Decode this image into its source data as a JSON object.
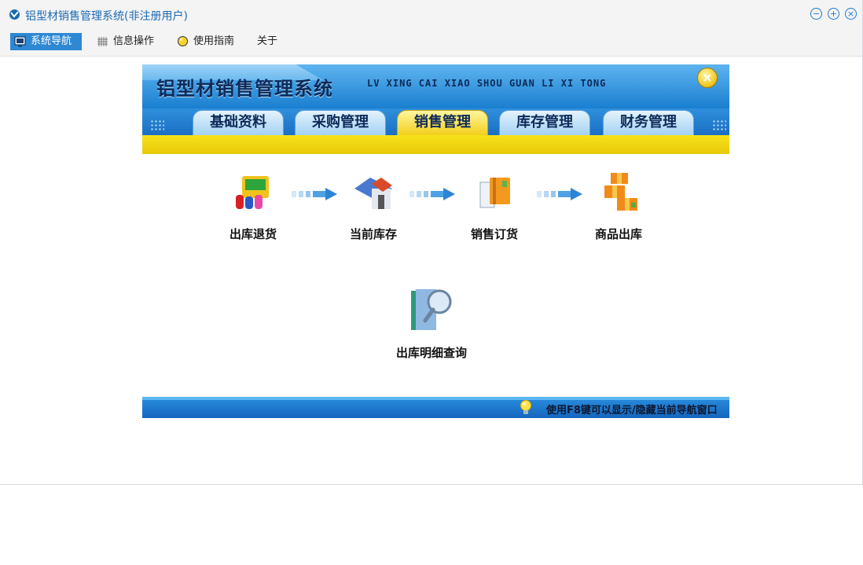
{
  "window": {
    "title": "铝型材销售管理系统(非注册用户)",
    "controls": {
      "minimize": "−",
      "maximize": "+",
      "close": "×"
    }
  },
  "menu": {
    "items": [
      {
        "label": "系统导航",
        "icon": "monitor-icon",
        "active": true
      },
      {
        "label": "信息操作",
        "icon": "grid-icon",
        "active": false
      },
      {
        "label": "使用指南",
        "icon": "lightbulb-icon",
        "active": false
      },
      {
        "label": "关于",
        "icon": "",
        "active": false
      }
    ]
  },
  "banner": {
    "title": "铝型材销售管理系统",
    "subtitle": "LV XING CAI XIAO SHOU GUAN LI XI TONG",
    "tabs": [
      {
        "label": "基础资料",
        "active": false
      },
      {
        "label": "采购管理",
        "active": false
      },
      {
        "label": "销售管理",
        "active": true
      },
      {
        "label": "库存管理",
        "active": false
      },
      {
        "label": "财务管理",
        "active": false
      }
    ],
    "close_icon": "close-circle-icon"
  },
  "workflow": {
    "items": [
      {
        "label": "出库退货",
        "icon": "shop-icon"
      },
      {
        "label": "当前库存",
        "icon": "warehouse-icon"
      },
      {
        "label": "销售订货",
        "icon": "order-book-icon"
      },
      {
        "label": "商品出库",
        "icon": "boxes-icon"
      },
      {
        "label": "出库明细查询",
        "icon": "magnifier-folder-icon"
      }
    ]
  },
  "footer": {
    "tip": "使用F8键可以显示/隐藏当前导航窗口"
  },
  "colors": {
    "accent": "#2e88d3",
    "title_text": "#1b69b3",
    "banner_blue": "#1a7fd0",
    "banner_yellow": "#f3cf1c"
  }
}
